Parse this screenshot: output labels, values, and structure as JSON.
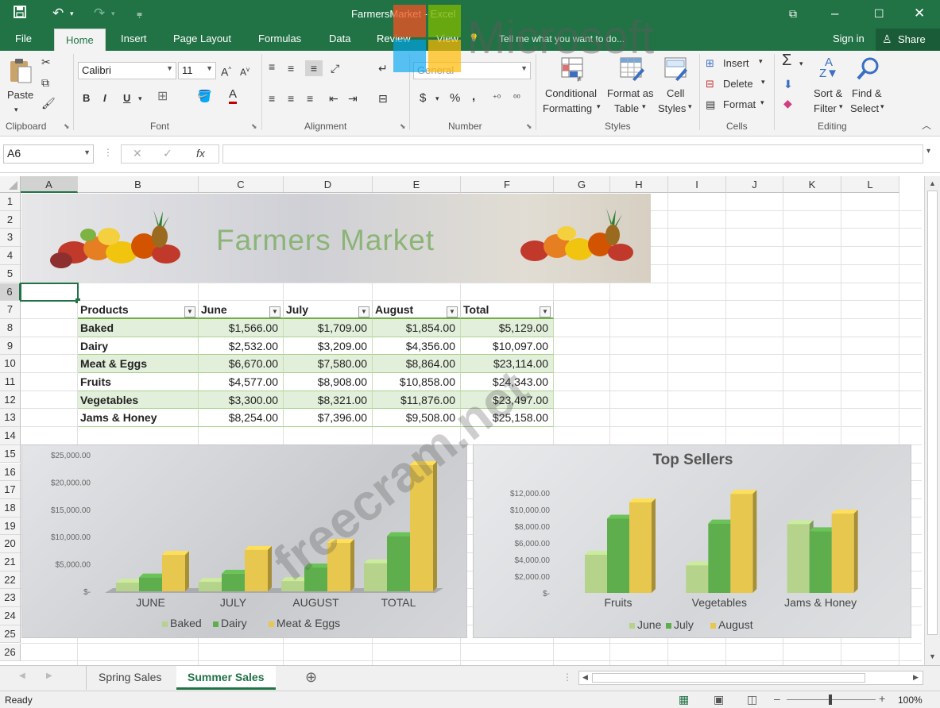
{
  "window": {
    "title_file": "FarmersMarket",
    "title_sep": " - ",
    "title_app": "Excel",
    "sign_in": "Sign in",
    "share": "Share"
  },
  "qat": {
    "save": "save-icon",
    "undo": "undo-icon",
    "redo": "redo-icon"
  },
  "tabs": [
    {
      "label": "File"
    },
    {
      "label": "Home"
    },
    {
      "label": "Insert"
    },
    {
      "label": "Page Layout"
    },
    {
      "label": "Formulas"
    },
    {
      "label": "Data"
    },
    {
      "label": "Review"
    },
    {
      "label": "View"
    }
  ],
  "tell_me": "Tell me what you want to do...",
  "ribbon": {
    "clipboard": {
      "label": "Clipboard",
      "paste": "Paste"
    },
    "font": {
      "label": "Font",
      "name": "Calibri",
      "size": "11",
      "bold": "B",
      "italic": "I",
      "underline": "U"
    },
    "alignment": {
      "label": "Alignment"
    },
    "number": {
      "label": "Number",
      "format": "General",
      "currency": "$",
      "percent": "%",
      "comma": ","
    },
    "styles": {
      "label": "Styles",
      "cond_1": "Conditional",
      "cond_2": "Formatting",
      "fmt_table_1": "Format as",
      "fmt_table_2": "Table",
      "cell_styles_1": "Cell",
      "cell_styles_2": "Styles"
    },
    "cells": {
      "label": "Cells",
      "insert": "Insert",
      "delete": "Delete",
      "format": "Format"
    },
    "editing": {
      "label": "Editing",
      "sort_1": "Sort &",
      "sort_2": "Filter",
      "find_1": "Find &",
      "find_2": "Select"
    }
  },
  "formula_bar": {
    "name_box": "A6",
    "fx": "fx",
    "value": ""
  },
  "columns": [
    "A",
    "B",
    "C",
    "D",
    "E",
    "F",
    "G",
    "H",
    "I",
    "J",
    "K",
    "L"
  ],
  "rows": [
    "1",
    "2",
    "3",
    "4",
    "5",
    "6",
    "7",
    "8",
    "9",
    "10",
    "11",
    "12",
    "13",
    "14",
    "15",
    "16",
    "17",
    "18",
    "19",
    "20",
    "21",
    "22",
    "23",
    "24",
    "25",
    "26"
  ],
  "banner": {
    "title": "Farmers Market"
  },
  "table": {
    "headers": [
      "Products",
      "June",
      "July",
      "August",
      "Total"
    ],
    "rows": [
      [
        "Baked",
        "$1,566.00",
        "$1,709.00",
        "$1,854.00",
        "$5,129.00"
      ],
      [
        "Dairy",
        "$2,532.00",
        "$3,209.00",
        "$4,356.00",
        "$10,097.00"
      ],
      [
        "Meat & Eggs",
        "$6,670.00",
        "$7,580.00",
        "$8,864.00",
        "$23,114.00"
      ],
      [
        "Fruits",
        "$4,577.00",
        "$8,908.00",
        "$10,858.00",
        "$24,343.00"
      ],
      [
        "Vegetables",
        "$3,300.00",
        "$8,321.00",
        "$11,876.00",
        "$23,497.00"
      ],
      [
        "Jams & Honey",
        "$8,254.00",
        "$7,396.00",
        "$9,508.00",
        "$25,158.00"
      ]
    ]
  },
  "chart_data": [
    {
      "type": "bar",
      "title": "",
      "categories": [
        "JUNE",
        "JULY",
        "AUGUST",
        "TOTAL"
      ],
      "series": [
        {
          "name": "Baked",
          "values": [
            1566,
            1709,
            1854,
            5129
          ],
          "color": "#b5d38a"
        },
        {
          "name": "Dairy",
          "values": [
            2532,
            3209,
            4356,
            10097
          ],
          "color": "#5fae4e"
        },
        {
          "name": "Meat & Eggs",
          "values": [
            6670,
            7580,
            8864,
            23114
          ],
          "color": "#e8c74e"
        }
      ],
      "yticks": [
        "$-",
        "$5,000.00",
        "$10,000.00",
        "$15,000.00",
        "$20,000.00",
        "$25,000.00"
      ],
      "ylim": [
        0,
        25000
      ],
      "legend": "bottom"
    },
    {
      "type": "bar",
      "title": "Top Sellers",
      "categories": [
        "Fruits",
        "Vegetables",
        "Jams & Honey"
      ],
      "series": [
        {
          "name": "June",
          "values": [
            4577,
            3300,
            8254
          ],
          "color": "#b5d38a"
        },
        {
          "name": "July",
          "values": [
            8908,
            8321,
            7396
          ],
          "color": "#5fae4e"
        },
        {
          "name": "August",
          "values": [
            10858,
            11876,
            9508
          ],
          "color": "#e8c74e"
        }
      ],
      "yticks": [
        "$-",
        "$2,000.00",
        "$4,000.00",
        "$6,000.00",
        "$8,000.00",
        "$10,000.00",
        "$12,000.00"
      ],
      "ylim": [
        0,
        12000
      ],
      "legend": "bottom"
    }
  ],
  "sheets": [
    {
      "label": "Spring Sales"
    },
    {
      "label": "Summer Sales"
    }
  ],
  "status": {
    "ready": "Ready",
    "zoom": "100%"
  },
  "watermark": {
    "brand": "Microsoft",
    "site": "freecram.net"
  }
}
